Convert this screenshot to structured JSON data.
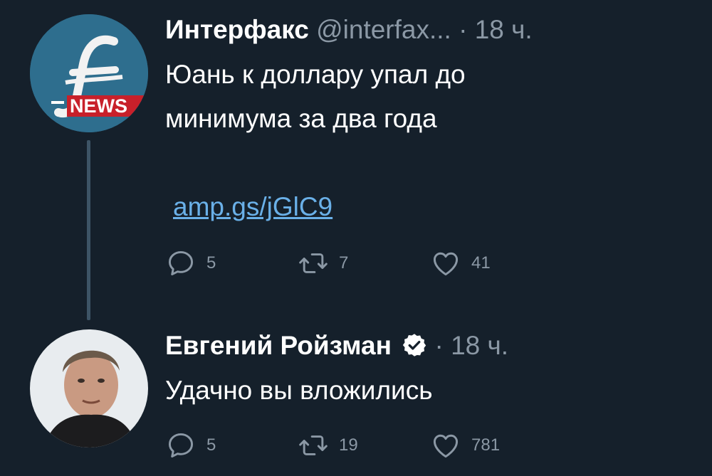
{
  "tweets": [
    {
      "author": "Интерфакс",
      "handle": "@interfax...",
      "dot": "·",
      "time": "18 ч.",
      "text": "Юань к доллару упал до\nминимума за два года",
      "link": "amp.gs/jGlC9",
      "avatar_logo_text": "NEWS",
      "replies": "5",
      "retweets": "7",
      "likes": "41"
    },
    {
      "author": "Евгений Ройзман",
      "dot": "·",
      "time": "18 ч.",
      "text": "Удачно вы вложились",
      "replies": "5",
      "retweets": "19",
      "likes": "781"
    }
  ],
  "icons": {
    "reply": "speech-bubble-icon",
    "retweet": "retweet-arrows-icon",
    "like": "heart-icon",
    "verified": "verified-badge-icon"
  },
  "colors": {
    "background": "#15202b",
    "secondary_text": "#8b98a5",
    "link": "#6ab0e8",
    "thread_line": "#3d5466"
  }
}
